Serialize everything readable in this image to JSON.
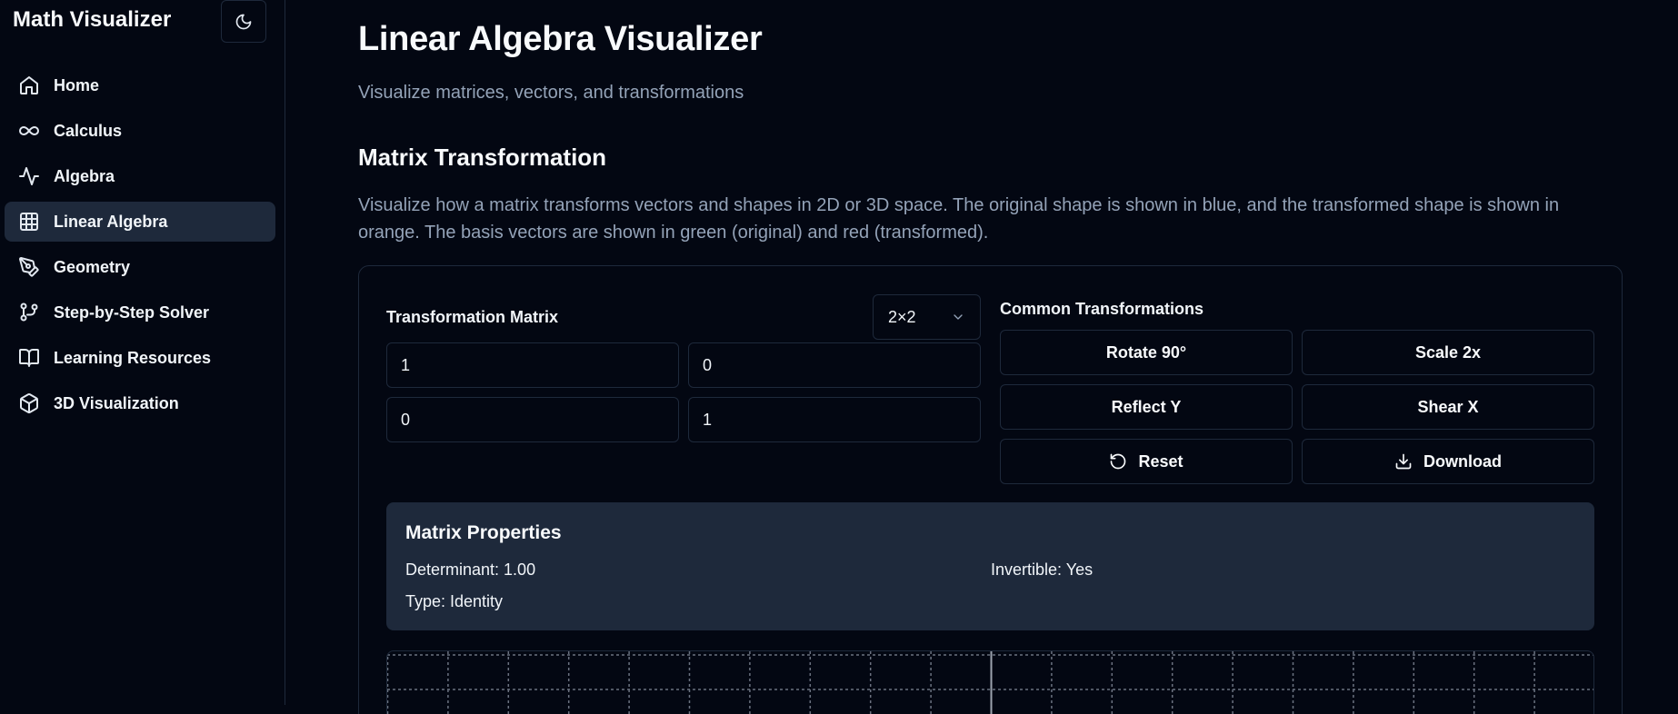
{
  "sidebar": {
    "brand": "Math Visualizer",
    "items": [
      {
        "label": "Home",
        "icon": "home-icon"
      },
      {
        "label": "Calculus",
        "icon": "infinity-icon"
      },
      {
        "label": "Algebra",
        "icon": "activity-icon"
      },
      {
        "label": "Linear Algebra",
        "icon": "grid-icon",
        "active": true
      },
      {
        "label": "Geometry",
        "icon": "pen-tool-icon"
      },
      {
        "label": "Step-by-Step Solver",
        "icon": "git-branch-icon"
      },
      {
        "label": "Learning Resources",
        "icon": "book-open-icon"
      },
      {
        "label": "3D Visualization",
        "icon": "box-icon"
      }
    ]
  },
  "header": {
    "title": "Linear Algebra Visualizer",
    "subtitle": "Visualize matrices, vectors, and transformations"
  },
  "section": {
    "title": "Matrix Transformation",
    "description": "Visualize how a matrix transforms vectors and shapes in 2D or 3D space. The original shape is shown in blue, and the transformed shape is shown in orange. The basis vectors are shown in green (original) and red (transformed)."
  },
  "matrix": {
    "label": "Transformation Matrix",
    "size": "2×2",
    "values": [
      "1",
      "0",
      "0",
      "1"
    ]
  },
  "transformations": {
    "label": "Common Transformations",
    "rotate": "Rotate 90°",
    "scale": "Scale 2x",
    "reflect": "Reflect Y",
    "shear": "Shear X",
    "reset": "Reset",
    "download": "Download"
  },
  "properties": {
    "title": "Matrix Properties",
    "determinant": "Determinant: 1.00",
    "invertible": "Invertible: Yes",
    "type": "Type: Identity"
  }
}
